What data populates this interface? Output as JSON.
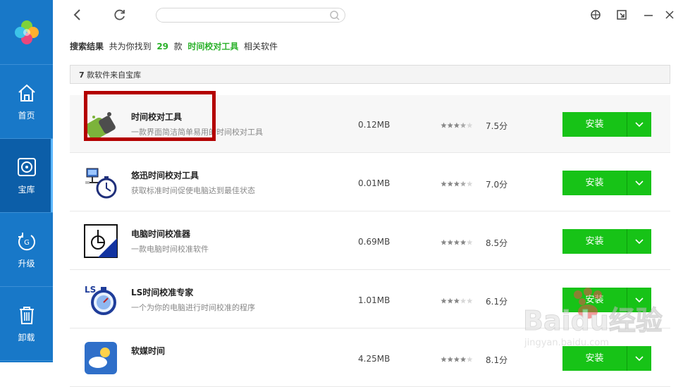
{
  "sidebar": {
    "items": [
      {
        "label": "首页",
        "icon": "home-icon"
      },
      {
        "label": "宝库",
        "icon": "disc-icon"
      },
      {
        "label": "升级",
        "icon": "upgrade-icon"
      },
      {
        "label": "卸载",
        "icon": "trash-icon"
      }
    ],
    "active": 1
  },
  "search": {
    "value": "",
    "placeholder": ""
  },
  "summary": {
    "label": "搜索结果",
    "prefix": "共为你找到",
    "count": "29",
    "unit": "款",
    "keyword": "时间校对工具",
    "suffix": "相关软件"
  },
  "source": {
    "count": "7",
    "text": "款软件来自宝库"
  },
  "apps": [
    {
      "name": "时间校对工具",
      "desc": "一款界面简洁简单易用的时间校对工具",
      "size": "0.12MB",
      "rating": 3.5,
      "score": "7.5分",
      "install": "安装"
    },
    {
      "name": "悠迅时间校对工具",
      "desc": "获取标准时间促使电脑达到最佳状态",
      "size": "0.01MB",
      "rating": 3.5,
      "score": "7.0分",
      "install": "安装"
    },
    {
      "name": "电脑时间校准器",
      "desc": "一款电脑时间校准软件",
      "size": "0.69MB",
      "rating": 4,
      "score": "8.5分",
      "install": "安装"
    },
    {
      "name": "LS时间校准专家",
      "desc": "一个为你的电脑进行时间校准的程序",
      "size": "1.01MB",
      "rating": 3,
      "score": "6.1分",
      "install": "安装"
    },
    {
      "name": "软媒时间",
      "desc": "",
      "size": "4.25MB",
      "rating": 4,
      "score": "8.1分",
      "install": "安装"
    }
  ],
  "watermark": {
    "text": "Baidu经验",
    "url": "jingyan.baidu.com"
  },
  "colors": {
    "sidebar": "#1878c8",
    "accent_green": "#17c317",
    "highlight_red": "#b40000"
  }
}
